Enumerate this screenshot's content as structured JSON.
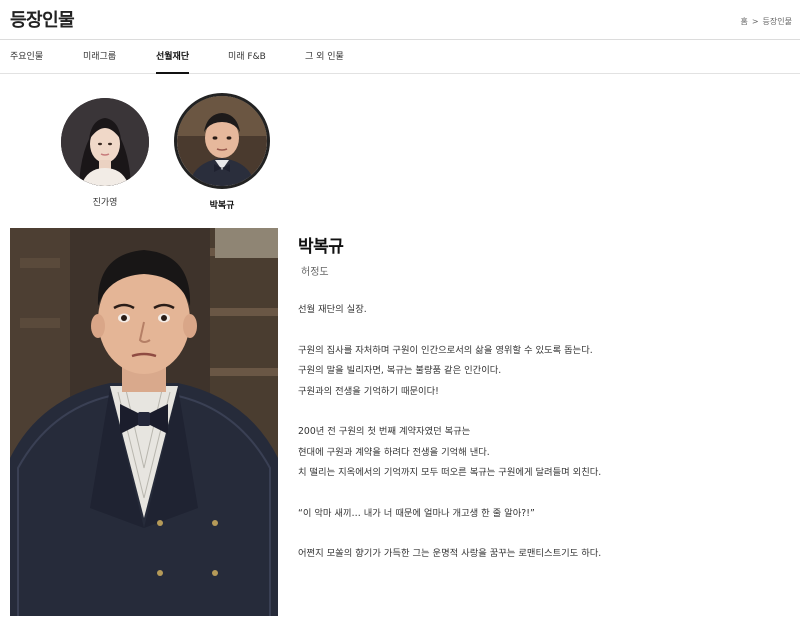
{
  "header": {
    "title": "등장인물",
    "breadcrumb": {
      "home": "홈",
      "separator": ">",
      "current": "등장인물"
    }
  },
  "tabs": [
    {
      "label": "주요인물",
      "active": false
    },
    {
      "label": "미래그룹",
      "active": false
    },
    {
      "label": "선월재단",
      "active": true
    },
    {
      "label": "미래 F&B",
      "active": false
    },
    {
      "label": "그 외 인물",
      "active": false
    }
  ],
  "characters": [
    {
      "name": "진가영",
      "selected": false,
      "icon": "character-avatar"
    },
    {
      "name": "박복규",
      "selected": true,
      "icon": "character-avatar"
    }
  ],
  "detail": {
    "name": "박복규",
    "actor": "허정도",
    "paragraphs": [
      [
        "선월 재단의 실장."
      ],
      [
        "구원의 집사를 자처하며 구원이 인간으로서의 삶을 영위할 수 있도록 돕는다.",
        "구원의 말을 빌리자면, 복규는 불량품 같은 인간이다.",
        "구원과의 전생을 기억하기 때문이다!"
      ],
      [
        "200년 전 구원의 첫 번째 계약자였던 복규는",
        "현대에 구원과 계약을 하려다 전생을 기억해 낸다.",
        "치 떨리는 지옥에서의 기억까지 모두 떠오른 복규는 구원에게 달려들며 외친다."
      ],
      [
        "“이 악마 새끼… 내가 너 때문에 얼마나 개고생 한 줄 알아?!”"
      ],
      [
        "어쩐지 모쏠의 향기가 가득한 그는 운명적 사랑을 꿈꾸는 로맨티스트기도 하다."
      ]
    ]
  },
  "colors": {
    "text": "#222222",
    "border": "#dcdcdc",
    "active_tab_underline": "#111111"
  }
}
